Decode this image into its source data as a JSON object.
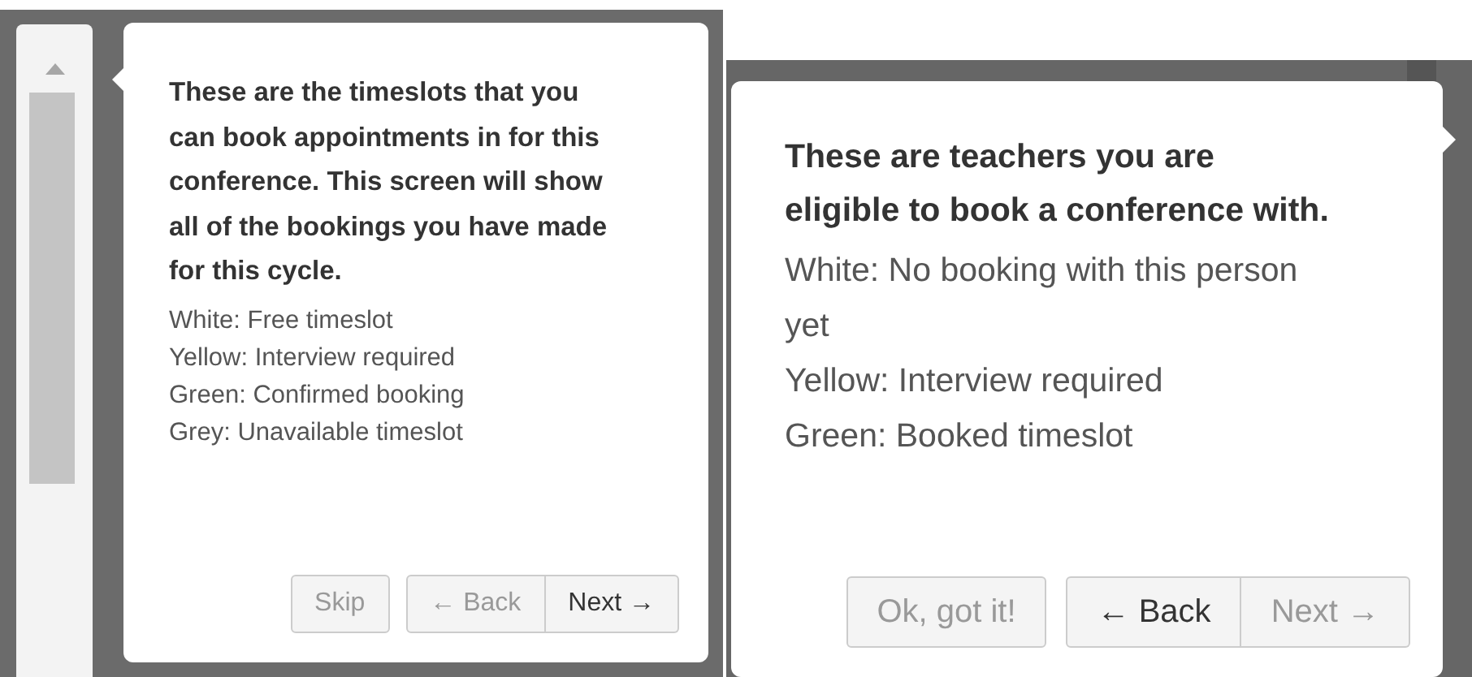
{
  "tours": [
    {
      "heading": "These are the timeslots that you can book appointments in for this conference. This screen will show all of the bookings you have made for this cycle.",
      "legend": [
        "White: Free timeslot",
        "Yellow: Interview required",
        "Green: Confirmed booking",
        "Grey: Unavailable timeslot"
      ],
      "buttons": [
        {
          "kind": "single",
          "label": "Skip",
          "disabled": true
        },
        {
          "kind": "group",
          "label": "← Back",
          "disabled": true
        },
        {
          "kind": "group",
          "label": "Next →",
          "disabled": false
        }
      ]
    },
    {
      "heading": "These are teachers you are eligible to book a conference with.",
      "legend": [
        "White: No booking with this person yet",
        "Yellow: Interview required",
        "Green: Booked timeslot"
      ],
      "buttons": [
        {
          "kind": "single",
          "label": "Ok, got it!",
          "disabled": true
        },
        {
          "kind": "group",
          "label": "← Back",
          "disabled": false
        },
        {
          "kind": "group",
          "label": "Next →",
          "disabled": true
        }
      ]
    }
  ]
}
